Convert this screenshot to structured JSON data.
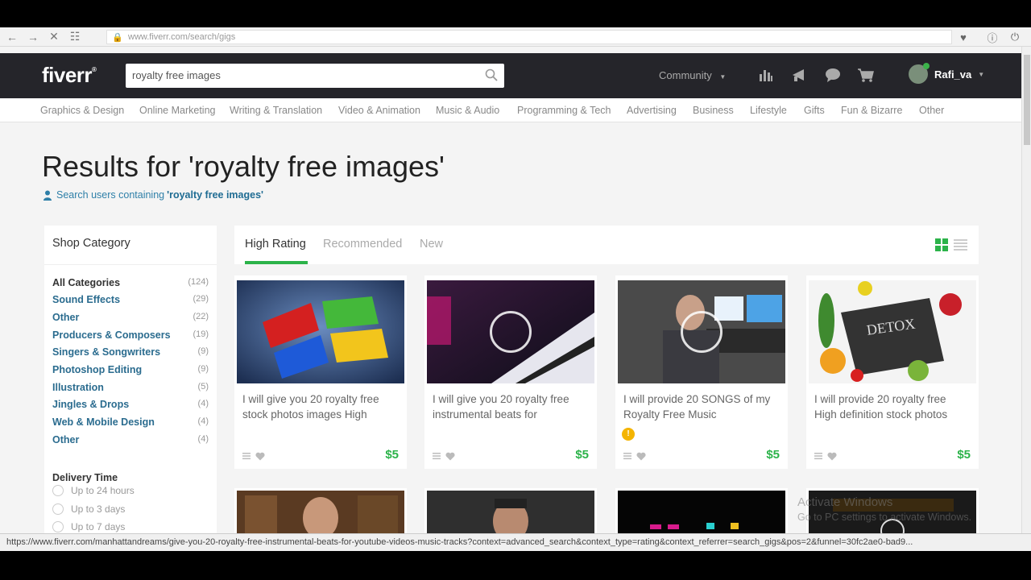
{
  "browser": {
    "url_domain": "www.fiverr.com",
    "url_path": "/search/gigs",
    "icons": [
      "back-icon",
      "forward-icon",
      "stop-icon",
      "reader-icon",
      "lock-icon",
      "pocket-icon",
      "info-icon",
      "power-icon"
    ]
  },
  "header": {
    "logo": "fiverr",
    "search_value": "royalty free images",
    "community_label": "Community",
    "username": "Rafi_va"
  },
  "categories": [
    "Graphics & Design",
    "Online Marketing",
    "Writing & Translation",
    "Video & Animation",
    "Music & Audio",
    "Programming & Tech",
    "Advertising",
    "Business",
    "Lifestyle",
    "Gifts",
    "Fun & Bizarre",
    "Other"
  ],
  "results": {
    "title": "Results for 'royalty free images'",
    "search_users_prefix": "Search users containing",
    "search_users_term": "'royalty free images'"
  },
  "sidebar": {
    "title": "Shop Category",
    "items": [
      {
        "label": "All Categories",
        "count": "(124)"
      },
      {
        "label": "Sound Effects",
        "count": "(29)"
      },
      {
        "label": "Other",
        "count": "(22)"
      },
      {
        "label": "Producers & Composers",
        "count": "(19)"
      },
      {
        "label": "Singers & Songwriters",
        "count": "(9)"
      },
      {
        "label": "Photoshop Editing",
        "count": "(9)"
      },
      {
        "label": "Illustration",
        "count": "(5)"
      },
      {
        "label": "Jingles & Drops",
        "count": "(4)"
      },
      {
        "label": "Web & Mobile Design",
        "count": "(4)"
      },
      {
        "label": "Other",
        "count": "(4)"
      }
    ],
    "delivery_title": "Delivery Time",
    "delivery_options": [
      "Up to 24 hours",
      "Up to 3 days",
      "Up to 7 days"
    ]
  },
  "tabs": [
    "High Rating",
    "Recommended",
    "New"
  ],
  "gigs": [
    {
      "title": "I will give you 20 royalty free stock photos images High",
      "price": "$5"
    },
    {
      "title": "I will give you 20 royalty free instrumental beats for",
      "price": "$5"
    },
    {
      "title": "I will provide 20 SONGS of my Royalty Free Music",
      "price": "$5"
    },
    {
      "title": "I will provide 20 royalty free High definition stock photos",
      "price": "$5"
    }
  ],
  "watermark": {
    "line1": "Activate Windows",
    "line2": "Go to PC settings to activate Windows."
  },
  "status_url": "https://www.fiverr.com/manhattandreams/give-you-20-royalty-free-instrumental-beats-for-youtube-videos-music-tracks?context=advanced_search&context_type=rating&context_referrer=search_gigs&pos=2&funnel=30fc2ae0-bad9..."
}
